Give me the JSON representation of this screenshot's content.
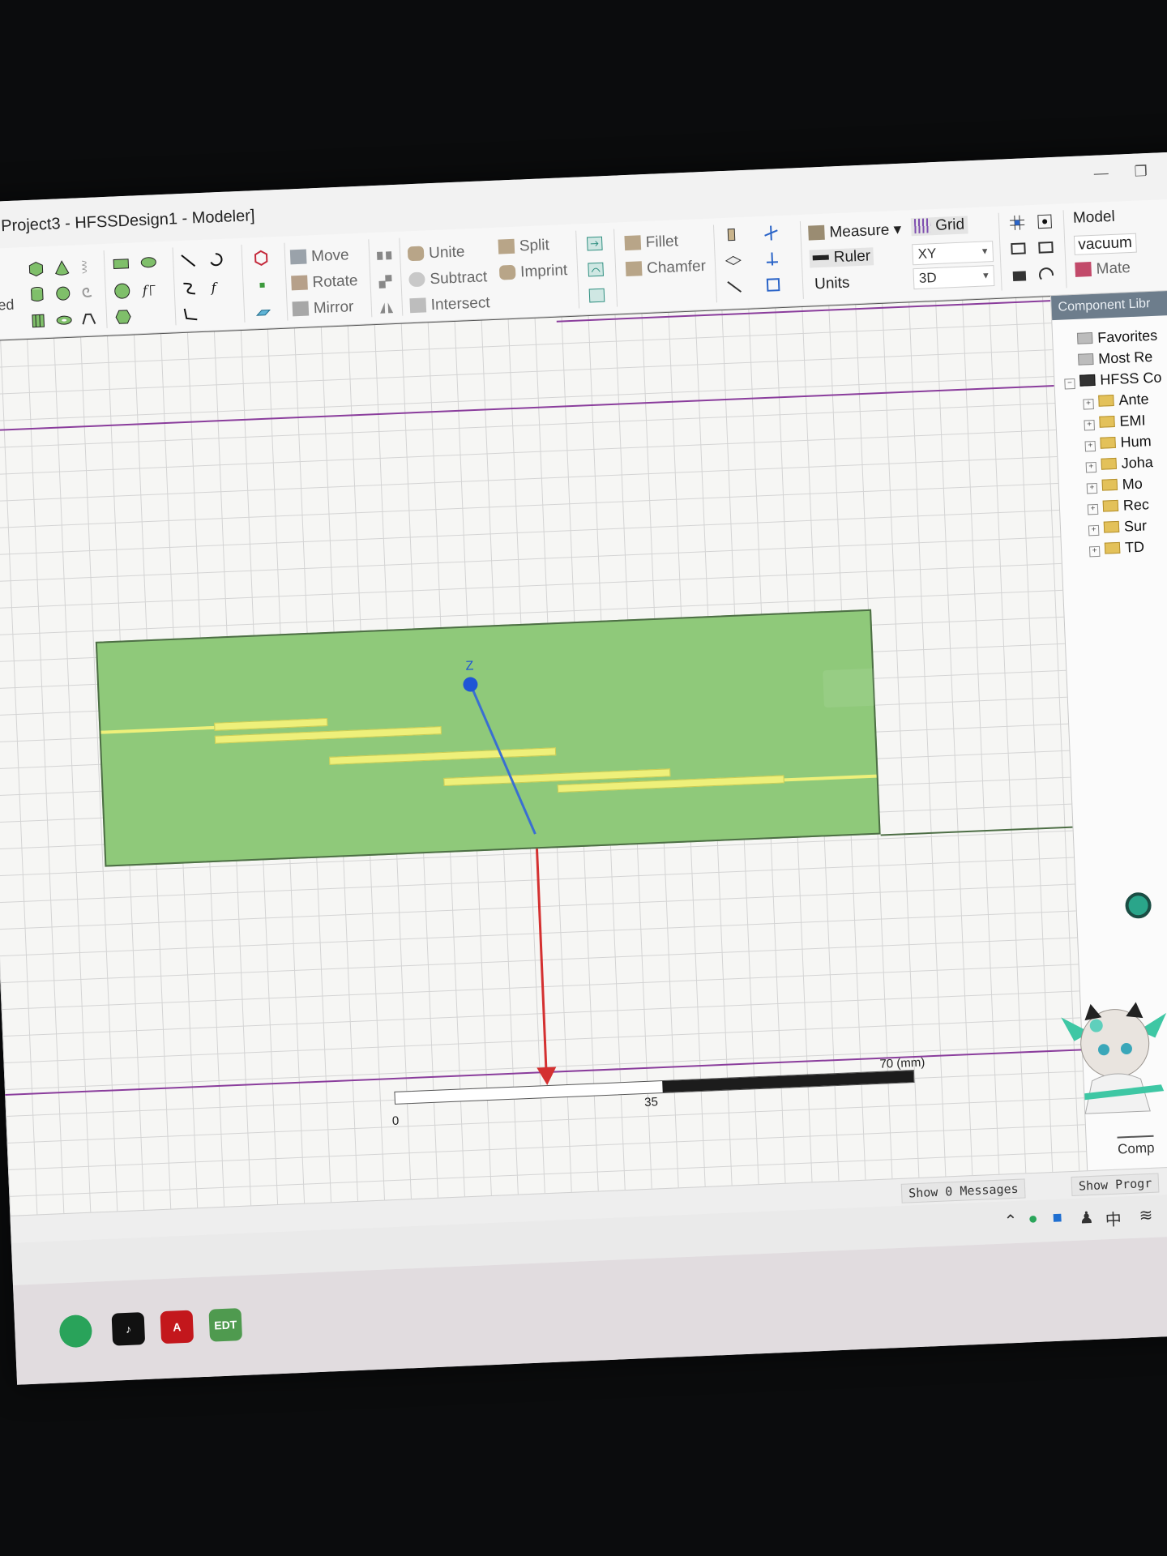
{
  "window": {
    "title": "Project3 - HFSSDesign1 - Modeler]"
  },
  "ribbon": {
    "left_cut_label": "ed",
    "transform": {
      "move": "Move",
      "rotate": "Rotate",
      "mirror": "Mirror"
    },
    "boolean": {
      "unite": "Unite",
      "subtract": "Subtract",
      "intersect": "Intersect",
      "split": "Split",
      "imprint": "Imprint"
    },
    "edge": {
      "fillet": "Fillet",
      "chamfer": "Chamfer"
    },
    "view": {
      "measure": "Measure",
      "ruler": "Ruler",
      "units": "Units",
      "grid": "Grid",
      "plane": "XY",
      "mode": "3D"
    },
    "model": {
      "label": "Model",
      "material": "vacuum",
      "materials_cut": "Mate"
    }
  },
  "viewport": {
    "z_axis_label": "Z",
    "ruler": {
      "start": "0",
      "mid": "35",
      "end": "70 (mm)"
    }
  },
  "component_library": {
    "header": "Component Libr",
    "items": [
      {
        "label": "Favorites"
      },
      {
        "label": "Most Re"
      },
      {
        "label": "HFSS Co"
      },
      {
        "label": "Ante"
      },
      {
        "label": "EMI"
      },
      {
        "label": "Hum"
      },
      {
        "label": "Joha"
      },
      {
        "label": "Mo"
      },
      {
        "label": "Rec"
      },
      {
        "label": "Sur"
      },
      {
        "label": "TD"
      }
    ],
    "footer": "Comp"
  },
  "status": {
    "messages": "Show 0 Messages",
    "progress": "Show Progr"
  },
  "tray": {
    "ime": "中"
  },
  "taskbar": {
    "apps": [
      "EDT"
    ]
  }
}
